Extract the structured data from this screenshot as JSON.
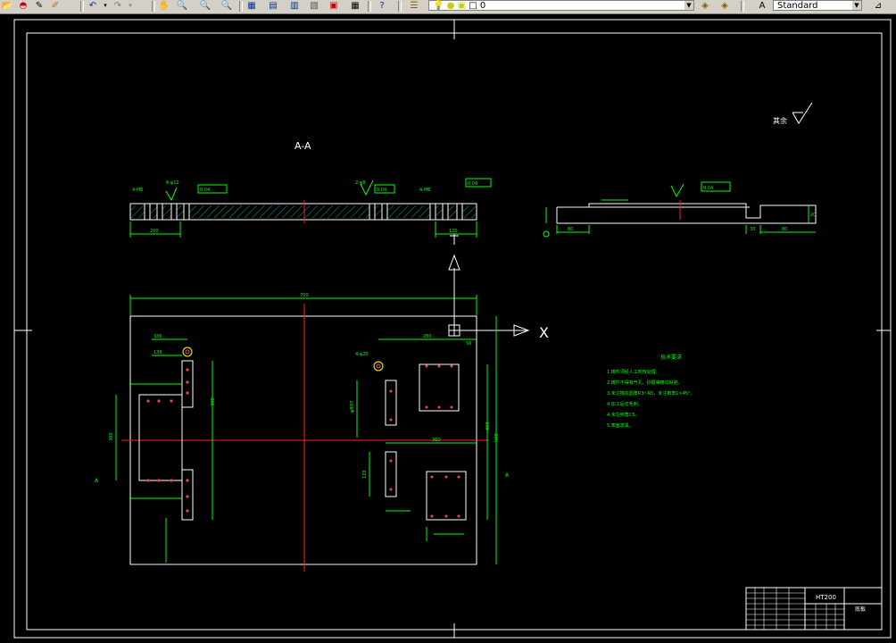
{
  "toolbar": {
    "layer_value": "0",
    "style_value": "Standard",
    "icons": [
      "open-icon",
      "save-icon",
      "pencil-icon",
      "brush-icon",
      "undo-icon",
      "redo-icon",
      "pan-icon",
      "zoom-realtime-icon",
      "zoom-window-icon",
      "zoom-previous-icon",
      "properties-icon",
      "design-center-icon",
      "tool-palettes-icon",
      "sheet-set-icon",
      "markup-icon",
      "calculator-icon",
      "help-icon",
      "layers-icon",
      "layer-state-icon",
      "layer-previous-icon",
      "text-style-icon"
    ]
  },
  "drawing": {
    "section_label": "A-A",
    "axis_x_label": "X",
    "section_mark_left": "A",
    "section_mark_right": "A",
    "surface_symbol_label": "其余",
    "tech_title": "技术要求",
    "tech_notes": [
      "1.铸件须经人工时效处理。",
      "2.铸件不得有气孔、砂眼等铸造缺陷。",
      "3.未注铸造圆角R3~R5，未注倒角1×45°。",
      "4.加工后去毛刺。",
      "4.未注倒角C5。",
      "5.表面发黑。"
    ],
    "dims": {
      "overall_width": "700",
      "sec_left_len": "200",
      "sec_right_len": "120",
      "side_left": "80",
      "side_right": "80",
      "side_mid": "33",
      "side_height": "20",
      "top_left_offset": "336",
      "left_col": "136",
      "right_offset": "280",
      "right_small": "56",
      "mid_offset": "360",
      "plate_height": "580",
      "right_height": "400",
      "left_height": "300",
      "vert_left": "120",
      "vert_right": "120",
      "hole_left": "4-φ20",
      "hole_right": "4-φ20",
      "left_big": "300",
      "center_marker": "60"
    },
    "tolerance_frames": [
      "0.04",
      "0.04",
      "0.04",
      "0.04"
    ],
    "datum": "A"
  },
  "title_block": {
    "material": "HT200",
    "name": "底板"
  }
}
